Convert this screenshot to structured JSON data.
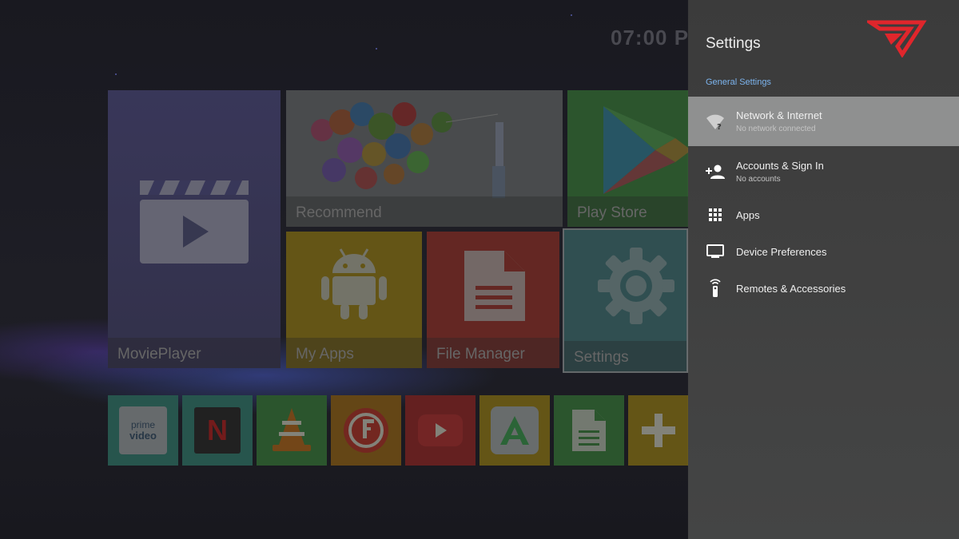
{
  "launcher": {
    "clock": "07:00 P",
    "tiles": {
      "movieplayer": "MoviePlayer",
      "recommend": "Recommend",
      "playstore": "Play Store",
      "myapps": "My Apps",
      "filemanager": "File Manager",
      "settings": "Settings"
    },
    "apps": {
      "prime": {
        "line1": "prime",
        "line2": "video"
      },
      "netflix": "N"
    }
  },
  "settings_panel": {
    "title": "Settings",
    "section": "General Settings",
    "items": [
      {
        "title": "Network & Internet",
        "subtitle": "No network connected",
        "icon": "wifi-unknown-icon",
        "selected": true
      },
      {
        "title": "Accounts & Sign In",
        "subtitle": "No accounts",
        "icon": "add-person-icon"
      },
      {
        "title": "Apps",
        "icon": "apps-grid-icon"
      },
      {
        "title": "Device Preferences",
        "icon": "tv-monitor-icon"
      },
      {
        "title": "Remotes & Accessories",
        "icon": "remote-icon"
      }
    ]
  },
  "colors": {
    "panel_bg": "#3f3f3f",
    "selected_item": "#8f9090",
    "section_accent": "#7cb4ee",
    "logo_red": "#e0262c"
  }
}
